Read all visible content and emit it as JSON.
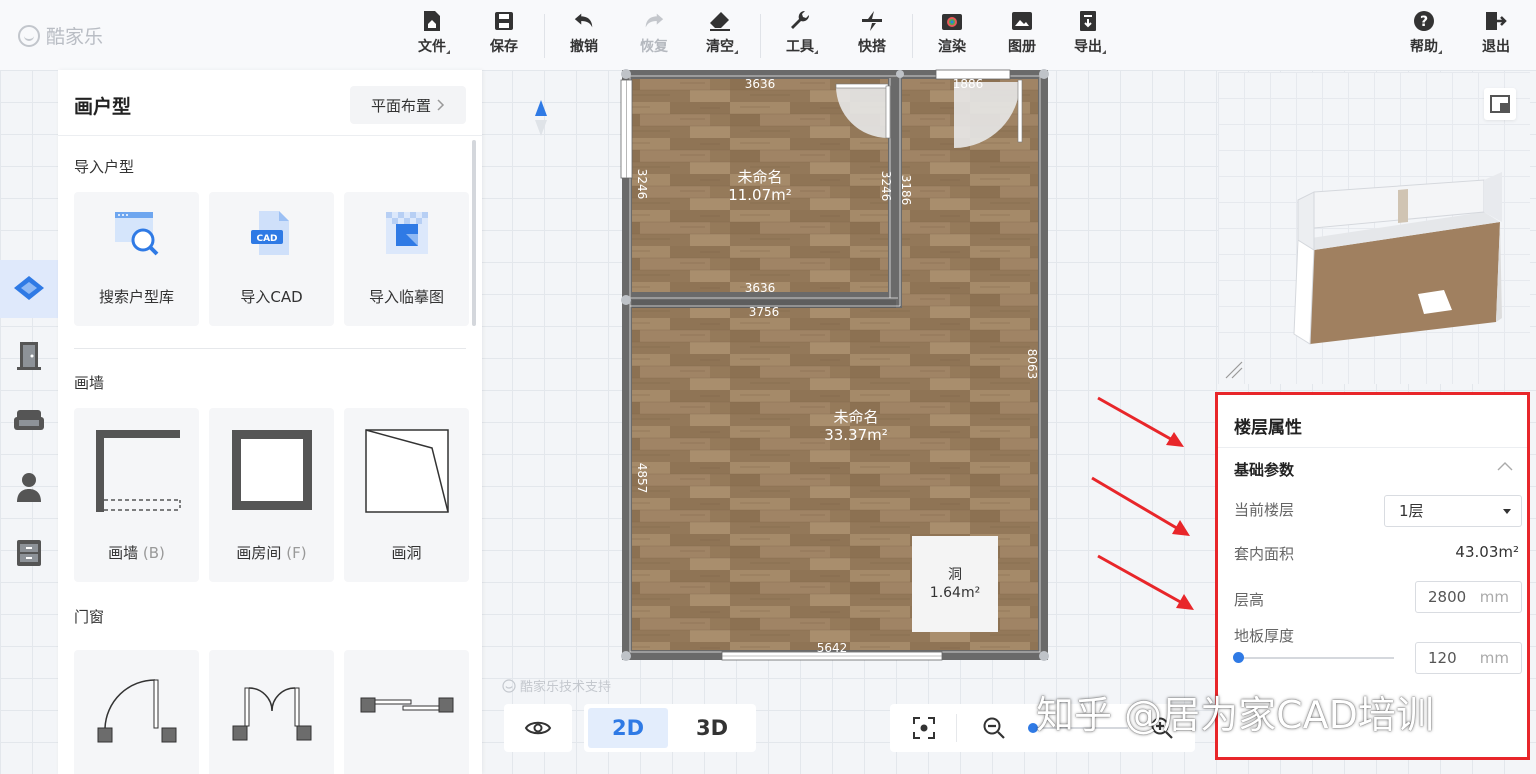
{
  "app": {
    "logo_text": "酷家乐"
  },
  "toolbar": {
    "file": "文件",
    "save": "保存",
    "undo": "撤销",
    "redo": "恢复",
    "clear": "清空",
    "tools": "工具",
    "quick": "快搭",
    "render": "渲染",
    "album": "图册",
    "export": "导出",
    "help": "帮助",
    "logout": "退出"
  },
  "panel": {
    "title": "画户型",
    "layout_button": "平面布置",
    "import_section": "导入户型",
    "import_items": [
      "搜索户型库",
      "导入CAD",
      "导入临摹图"
    ],
    "cad_badge": "CAD",
    "wall_section": "画墙",
    "wall_items": [
      {
        "label": "画墙",
        "key": "(B)"
      },
      {
        "label": "画房间",
        "key": "(F)"
      },
      {
        "label": "画洞",
        "key": ""
      }
    ],
    "door_section": "门窗"
  },
  "plan": {
    "rooms": [
      {
        "name": "未命名",
        "area": "11.07m²"
      },
      {
        "name": "未命名",
        "area": "33.37m²"
      }
    ],
    "hole": {
      "name": "洞",
      "area": "1.64m²"
    },
    "dims": {
      "top_left": "3636",
      "top_right": "1886",
      "left_upper": "3246",
      "inner_v1": "3246",
      "inner_v2": "3186",
      "mid_upper": "3636",
      "mid_lower": "3756",
      "right": "8063",
      "left_lower": "4857",
      "bottom": "5642"
    },
    "watermark": "酷家乐技术支持"
  },
  "view": {
    "mode_2d": "2D",
    "mode_3d": "3D",
    "active": "2D"
  },
  "props": {
    "title": "楼层属性",
    "section": "基础参数",
    "floor_label": "当前楼层",
    "floor_value": "1层",
    "area_label": "套内面积",
    "area_value": "43.03m²",
    "height_label": "层高",
    "height_value": "2800",
    "thickness_label": "地板厚度",
    "thickness_value": "120",
    "unit": "mm",
    "slider_level": 0
  },
  "overlay": {
    "credit": "知乎 @居为家CAD培训",
    "arrow_color": "#e8262a",
    "frame_color": "#e8262a"
  },
  "colors": {
    "accent": "#2f7ae5",
    "wall": "#6b6b6b",
    "floor_wood": "#9b8060"
  }
}
